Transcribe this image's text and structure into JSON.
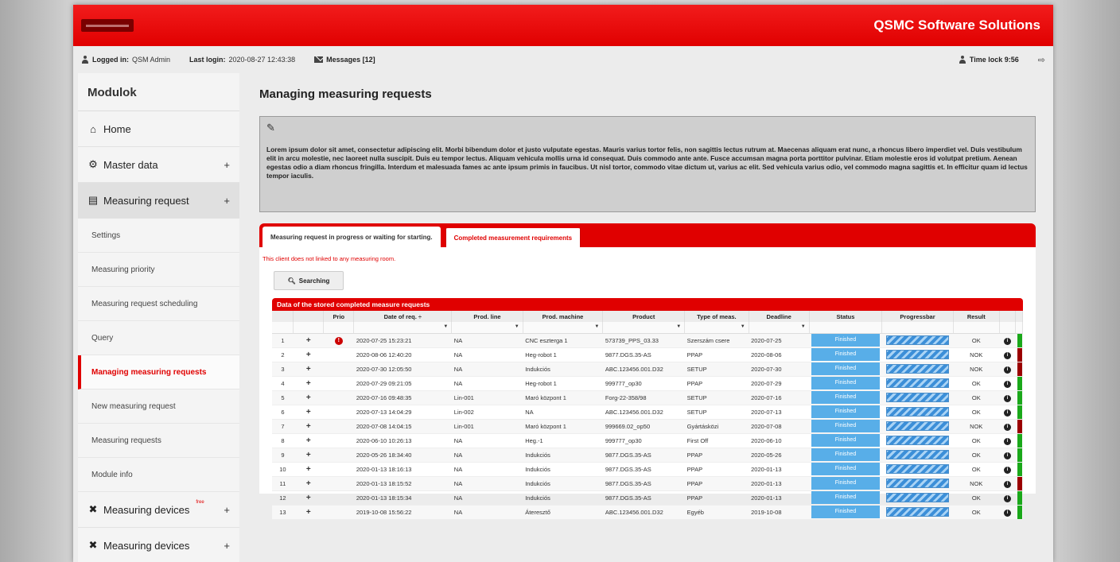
{
  "header": {
    "brand": "QSMC Software Solutions"
  },
  "topbar": {
    "logged_in_label": "Logged in:",
    "logged_in_user": "QSM Admin",
    "last_login_label": "Last login:",
    "last_login_value": "2020-08-27 12:43:38",
    "messages": "Messages [12]",
    "time_lock": "Time lock 9:56"
  },
  "sidebar": {
    "title": "Modulok",
    "home": "Home",
    "master_data": "Master data",
    "measuring_request": "Measuring request",
    "sub": [
      "Settings",
      "Measuring priority",
      "Measuring request scheduling",
      "Query",
      "Managing measuring requests",
      "New measuring request",
      "Measuring requests",
      "Module info"
    ],
    "measuring_devices_1": "Measuring devices",
    "free_badge": "free",
    "measuring_devices_2": "Measuring devices"
  },
  "main": {
    "title": "Managing measuring requests",
    "note_text": "Lorem ipsum dolor sit amet, consectetur adipiscing elit. Morbi bibendum dolor et justo vulputate egestas. Mauris varius tortor felis, non sagittis lectus rutrum at. Maecenas aliquam erat nunc, a rhoncus libero imperdiet vel. Duis vestibulum elit in arcu molestie, nec laoreet nulla suscipit. Duis eu tempor lectus. Aliquam vehicula mollis urna id consequat. Duis commodo ante ante. Fusce accumsan magna porta porttitor pulvinar. Etiam molestie eros id volutpat pretium. Aenean egestas odio a diam rhoncus fringilla. Interdum et malesuada fames ac ante ipsum primis in faucibus. Ut nisl tortor, commodo vitae dictum ut, varius ac elit. Sed vehicula varius odio, vel commodo magna sagittis et. In efficitur quam id lectus tempor iaculis.",
    "tab_1": "Measuring request in progress or waiting for starting.",
    "tab_2": "Completed measurement requirements",
    "warning": "This client does not linked to any measuring room.",
    "search_button": "Searching",
    "grid_title": "Data of the stored completed measure requests",
    "columns": [
      "",
      "",
      "Prio",
      "Date of req.",
      "Prod. line",
      "Prod. machine",
      "Product",
      "Type of meas.",
      "Deadline",
      "Status",
      "Progressbar",
      "Result",
      "",
      ""
    ],
    "rows": [
      {
        "n": "1",
        "prio": "!",
        "date": "2020-07-25 15:23:21",
        "line": "NA",
        "machine": "CNC esztergа 1",
        "product": "573739_PPS_03.33",
        "type": "Szerszám csere",
        "deadline": "2020-07-25",
        "status": "Finished",
        "result": "OK"
      },
      {
        "n": "2",
        "prio": "",
        "date": "2020-08-06 12:40:20",
        "line": "NA",
        "machine": "Heg-robot 1",
        "product": "9877.DGS.35-AS",
        "type": "PPAP",
        "deadline": "2020-08-06",
        "status": "Finished",
        "result": "NOK"
      },
      {
        "n": "3",
        "prio": "",
        "date": "2020-07-30 12:05:50",
        "line": "NA",
        "machine": "Indukciós",
        "product": "ABC.123456.001.D32",
        "type": "SETUP",
        "deadline": "2020-07-30",
        "status": "Finished",
        "result": "NOK"
      },
      {
        "n": "4",
        "prio": "",
        "date": "2020-07-29 09:21:05",
        "line": "NA",
        "machine": "Heg-robot 1",
        "product": "999777_op30",
        "type": "PPAP",
        "deadline": "2020-07-29",
        "status": "Finished",
        "result": "OK"
      },
      {
        "n": "5",
        "prio": "",
        "date": "2020-07-16 09:48:35",
        "line": "Lin-001",
        "machine": "Maró központ 1",
        "product": "Forg-22-358/98",
        "type": "SETUP",
        "deadline": "2020-07-16",
        "status": "Finished",
        "result": "OK"
      },
      {
        "n": "6",
        "prio": "",
        "date": "2020-07-13 14:04:29",
        "line": "Lin-002",
        "machine": "NA",
        "product": "ABC.123456.001.D32",
        "type": "SETUP",
        "deadline": "2020-07-13",
        "status": "Finished",
        "result": "OK"
      },
      {
        "n": "7",
        "prio": "",
        "date": "2020-07-08 14:04:15",
        "line": "Lin-001",
        "machine": "Maró központ 1",
        "product": "999669.02_op50",
        "type": "Gyártásközi",
        "deadline": "2020-07-08",
        "status": "Finished",
        "result": "NOK"
      },
      {
        "n": "8",
        "prio": "",
        "date": "2020-06-10 10:26:13",
        "line": "NA",
        "machine": "Heg.-1",
        "product": "999777_op30",
        "type": "First Off",
        "deadline": "2020-06-10",
        "status": "Finished",
        "result": "OK"
      },
      {
        "n": "9",
        "prio": "",
        "date": "2020-05-26 18:34:40",
        "line": "NA",
        "machine": "Indukciós",
        "product": "9877.DGS.35-AS",
        "type": "PPAP",
        "deadline": "2020-05-26",
        "status": "Finished",
        "result": "OK"
      },
      {
        "n": "10",
        "prio": "",
        "date": "2020-01-13 18:16:13",
        "line": "NA",
        "machine": "Indukciós",
        "product": "9877.DGS.35-AS",
        "type": "PPAP",
        "deadline": "2020-01-13",
        "status": "Finished",
        "result": "OK"
      },
      {
        "n": "11",
        "prio": "",
        "date": "2020-01-13 18:15:52",
        "line": "NA",
        "machine": "Indukciós",
        "product": "9877.DGS.35-AS",
        "type": "PPAP",
        "deadline": "2020-01-13",
        "status": "Finished",
        "result": "NOK"
      },
      {
        "n": "12",
        "prio": "",
        "date": "2020-01-13 18:15:34",
        "line": "NA",
        "machine": "Indukciós",
        "product": "9877.DGS.35-AS",
        "type": "PPAP",
        "deadline": "2020-01-13",
        "status": "Finished",
        "result": "OK"
      },
      {
        "n": "13",
        "prio": "",
        "date": "2019-10-08 15:56:22",
        "line": "NA",
        "machine": "Áteresztő",
        "product": "ABC.123456.001.D32",
        "type": "Egyéb",
        "deadline": "2019-10-08",
        "status": "Finished",
        "result": "OK"
      }
    ]
  },
  "colors": {
    "accent": "#e00000",
    "status": "#58aee8",
    "ok": "#1aa81a",
    "nok": "#9b0000"
  },
  "icons": {
    "user": "user-icon",
    "mail": "mail-icon",
    "lock": "lock-user-icon",
    "logout": "logout-icon",
    "home": "home-icon",
    "gear": "gears-icon",
    "list": "list-icon",
    "tools": "tools-icon",
    "edit": "edit-icon",
    "search": "search-icon",
    "info": "info-icon",
    "prio": "exclamation-icon"
  }
}
